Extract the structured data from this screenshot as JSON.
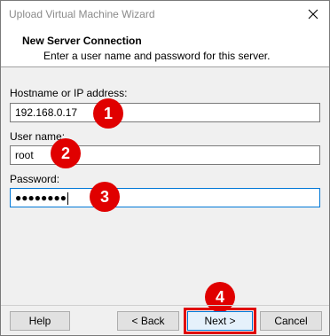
{
  "window": {
    "title": "Upload Virtual Machine Wizard"
  },
  "header": {
    "title": "New Server Connection",
    "subtitle": "Enter a user name and password for this server."
  },
  "form": {
    "hostname_label": "Hostname or IP address:",
    "hostname_value": "192.168.0.17",
    "username_label": "User name:",
    "username_value": "root",
    "password_label": "Password:",
    "password_masked": "●●●●●●●●"
  },
  "markers": [
    "1",
    "2",
    "3",
    "4"
  ],
  "buttons": {
    "help": "Help",
    "back": "< Back",
    "next": "Next >",
    "cancel": "Cancel"
  },
  "colors": {
    "marker": "#e00000",
    "focus": "#0078d7"
  },
  "icons": {
    "close": "close-icon"
  }
}
